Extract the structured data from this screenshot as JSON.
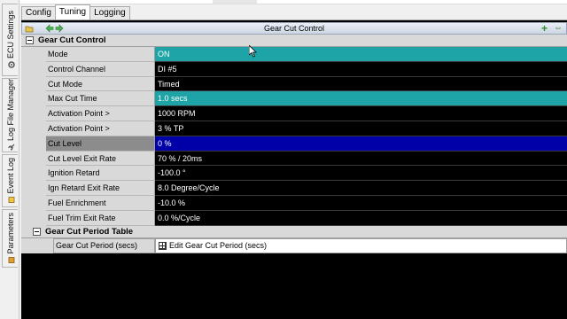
{
  "vertical_tabs": [
    {
      "label": "ECU Settings",
      "icon": "gear-icon"
    },
    {
      "label": "Log File Manager",
      "icon": "wrench-icon"
    },
    {
      "label": "Event Log",
      "icon": "log-icon"
    },
    {
      "label": "Parameters",
      "icon": "parameters-icon"
    }
  ],
  "tabs": [
    {
      "label": "Config"
    },
    {
      "label": "Tuning"
    },
    {
      "label": "Logging"
    }
  ],
  "panel": {
    "title": "Gear Cut Control",
    "add_symbol": "+",
    "pin_symbol": "⇔"
  },
  "category": {
    "label": "Gear Cut Control",
    "rows": [
      {
        "name": "Mode",
        "value": "ON"
      },
      {
        "name": "Control Channel",
        "value": "DI #5"
      },
      {
        "name": "Cut Mode",
        "value": "Timed"
      },
      {
        "name": "Max Cut Time",
        "value": "1.0 secs"
      },
      {
        "name": "Activation Point >",
        "value": "1000  RPM"
      },
      {
        "name": "Activation Point >",
        "value": "3 % TP"
      },
      {
        "name": "Cut Level",
        "value": "0 %"
      },
      {
        "name": "Cut Level Exit Rate",
        "value": "70 % / 20ms"
      },
      {
        "name": "Ignition Retard",
        "value": "-100.0 °"
      },
      {
        "name": "Ign Retard Exit Rate",
        "value": "8.0 Degree/Cycle"
      },
      {
        "name": "Fuel Enrichment",
        "value": "-10.0 %"
      },
      {
        "name": "Fuel Trim Exit Rate",
        "value": "0.0 %/Cycle"
      }
    ]
  },
  "subcategory": {
    "label": "Gear Cut Period Table",
    "row": {
      "name": "Gear Cut Period (secs)",
      "value": "Edit Gear Cut Period (secs)"
    }
  },
  "colors": {
    "highlight_teal": "#1ea3a6",
    "selected_blue": "#0000a8",
    "value_bg": "#000000"
  }
}
